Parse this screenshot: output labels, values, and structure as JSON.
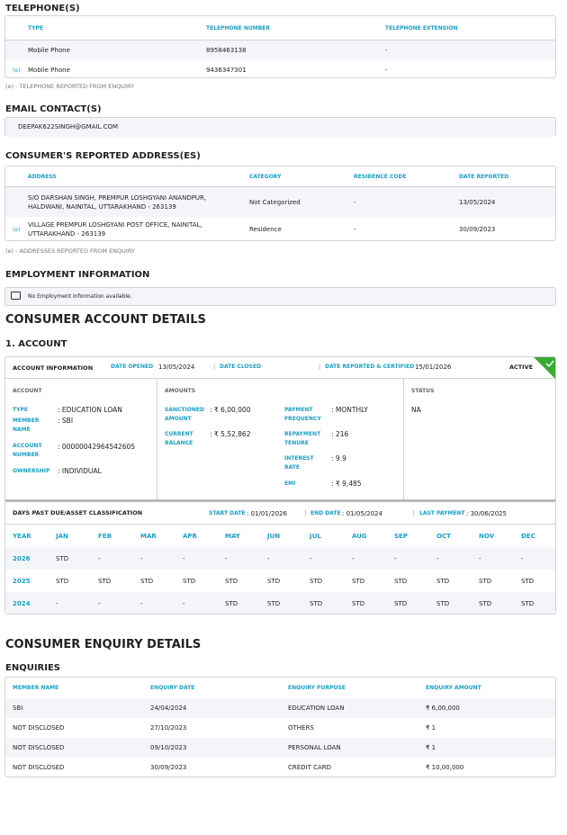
{
  "telephones": {
    "title": "TELEPHONE(S)",
    "headers": [
      "TYPE",
      "TELEPHONE NUMBER",
      "TELEPHONE EXTENSION"
    ],
    "rows": [
      {
        "flag": "",
        "type": "Mobile Phone",
        "number": "8958463138",
        "ext": "-"
      },
      {
        "flag": "(e)",
        "type": "Mobile Phone",
        "number": "9436347301",
        "ext": "-"
      }
    ],
    "footnote": "(e) - TELEPHONE REPORTED FROM ENQUIRY"
  },
  "email": {
    "title": "EMAIL CONTACT(S)",
    "value": "DEEPAK622SINGH@GMAIL.COM"
  },
  "addresses": {
    "title": "CONSUMER'S REPORTED ADDRESS(ES)",
    "headers": [
      "ADDRESS",
      "CATEGORY",
      "RESIDENCE CODE",
      "DATE REPORTED"
    ],
    "rows": [
      {
        "flag": "",
        "address": "S/O DARSHAN SINGH, PREMPUR LOSHGYANI ANANDPUR, HALDWANI, NAINITAL, UTTARAKHAND - 263139",
        "category": "Not Categorized",
        "code": "-",
        "date": "13/05/2024"
      },
      {
        "flag": "(e)",
        "address": "VILLAGE PREMPUR LOSHGYANI POST OFFICE, NAINITAL, UTTARAKHAND - 263139",
        "category": "Residence",
        "code": "-",
        "date": "30/09/2023"
      }
    ],
    "footnote": "(e) - ADDRESSES REPORTED FROM ENQUIRY"
  },
  "employment": {
    "title": "EMPLOYMENT INFORMATION",
    "message": "No Employment Information available."
  },
  "account_details": {
    "title": "CONSUMER ACCOUNT DETAILS",
    "subtitle": "1. ACCOUNT",
    "info": {
      "label": "ACCOUNT INFORMATION",
      "date_opened_label": "DATE OPENED",
      "date_opened": "13/05/2024",
      "date_closed_label": "DATE CLOSED",
      "date_closed": "",
      "date_reported_label": "DATE REPORTED & CERTIFIED",
      "date_reported": "15/01/2026",
      "status": "ACTIVE"
    },
    "account": {
      "heading": "ACCOUNT",
      "type_label": "TYPE",
      "type": "EDUCATION LOAN",
      "member_label": "MEMBER NAME",
      "member": "SBI",
      "number_label": "ACCOUNT NUMBER",
      "number": "00000042964542605",
      "ownership_label": "OWNERSHIP",
      "ownership": "INDIVIDUAL"
    },
    "amounts": {
      "heading": "AMOUNTS",
      "sanctioned_label": "SANCTIONED AMOUNT",
      "sanctioned": "₹ 6,00,000",
      "balance_label": "CURRENT BALANCE",
      "balance": "₹ 5,52,862",
      "freq_label": "PAYMENT FREQUENCY",
      "freq": "MONTHLY",
      "tenure_label": "REPAYMENT TENURE",
      "tenure": "216",
      "rate_label": "INTEREST RATE",
      "rate": "9.9",
      "emi_label": "EMI",
      "emi": "₹ 9,485"
    },
    "status": {
      "heading": "STATUS",
      "value": "NA"
    },
    "dpd": {
      "label": "DAYS PAST DUE/ASSET CLASSIFICATION",
      "start_label": "START DATE",
      "start": "01/01/2026",
      "end_label": "END DATE",
      "end": "01/05/2024",
      "last_label": "LAST PAYMENT",
      "last": "30/06/2025",
      "months": [
        "YEAR",
        "JAN",
        "FEB",
        "MAR",
        "APR",
        "MAY",
        "JUN",
        "JUL",
        "AUG",
        "SEP",
        "OCT",
        "NOV",
        "DEC"
      ],
      "rows": [
        [
          "2026",
          "STD",
          "-",
          "-",
          "-",
          "-",
          "-",
          "-",
          "-",
          "-",
          "-",
          "-",
          "-"
        ],
        [
          "2025",
          "STD",
          "STD",
          "STD",
          "STD",
          "STD",
          "STD",
          "STD",
          "STD",
          "STD",
          "STD",
          "STD",
          "STD"
        ],
        [
          "2024",
          "-",
          "-",
          "-",
          "-",
          "STD",
          "STD",
          "STD",
          "STD",
          "STD",
          "STD",
          "STD",
          "STD"
        ]
      ]
    }
  },
  "enquiry_details": {
    "title": "CONSUMER ENQUIRY DETAILS",
    "subtitle": "ENQUIRIES",
    "headers": [
      "MEMBER NAME",
      "ENQUIRY DATE",
      "ENQUIRY PURPOSE",
      "ENQUIRY AMOUNT"
    ],
    "rows": [
      [
        "SBI",
        "24/04/2024",
        "EDUCATION LOAN",
        "₹ 6,00,000"
      ],
      [
        "NOT DISCLOSED",
        "27/10/2023",
        "OTHERS",
        "₹ 1"
      ],
      [
        "NOT DISCLOSED",
        "09/10/2023",
        "PERSONAL LOAN",
        "₹ 1"
      ],
      [
        "NOT DISCLOSED",
        "30/09/2023",
        "CREDIT CARD",
        "₹ 10,00,000"
      ]
    ]
  }
}
